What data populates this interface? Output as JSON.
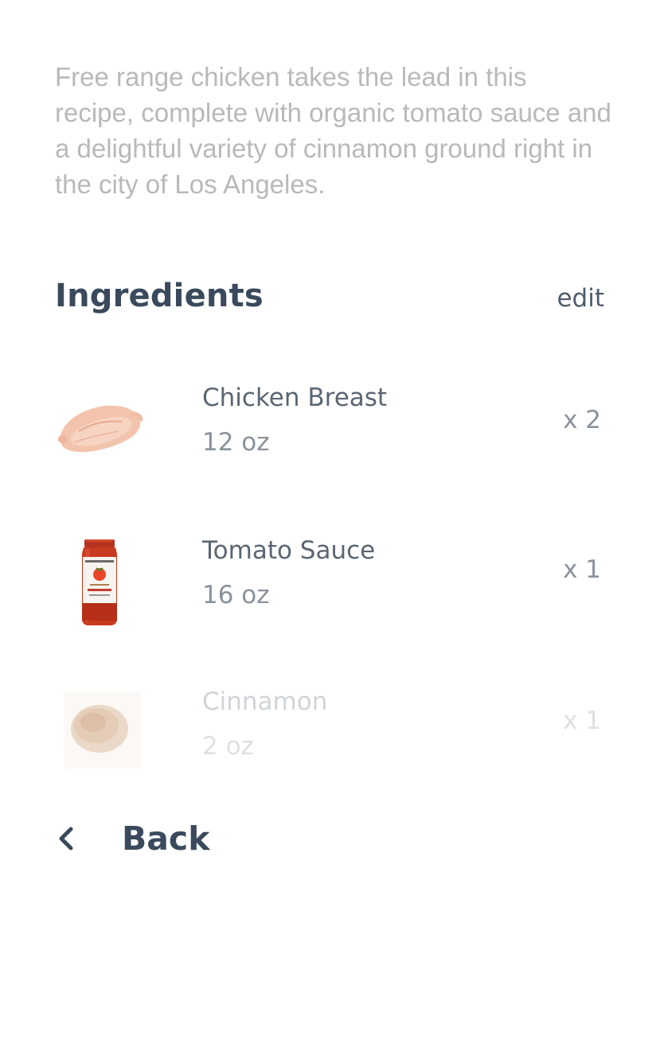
{
  "description": "Free range chicken takes the lead in this recipe, complete with organic tomato sauce and a delightful variety of cinnamon ground right in the city of Los Angeles.",
  "ingredients_section": {
    "title": "Ingredients",
    "edit_label": "edit"
  },
  "ingredients": [
    {
      "name": "Chicken Breast",
      "amount": "12 oz",
      "quantity": "x 2",
      "icon": "chicken-breast-image"
    },
    {
      "name": "Tomato Sauce",
      "amount": "16 oz",
      "quantity": "x 1",
      "icon": "tomato-sauce-jar-image"
    },
    {
      "name": "Cinnamon",
      "amount": "2 oz",
      "quantity": "x 1",
      "icon": "cinnamon-powder-image"
    }
  ],
  "navigation": {
    "back_label": "Back",
    "back_icon": "chevron-left-icon"
  },
  "colors": {
    "heading": "#3a4a5c",
    "description_text": "#b9b9b9",
    "secondary_text": "#8a929c"
  }
}
